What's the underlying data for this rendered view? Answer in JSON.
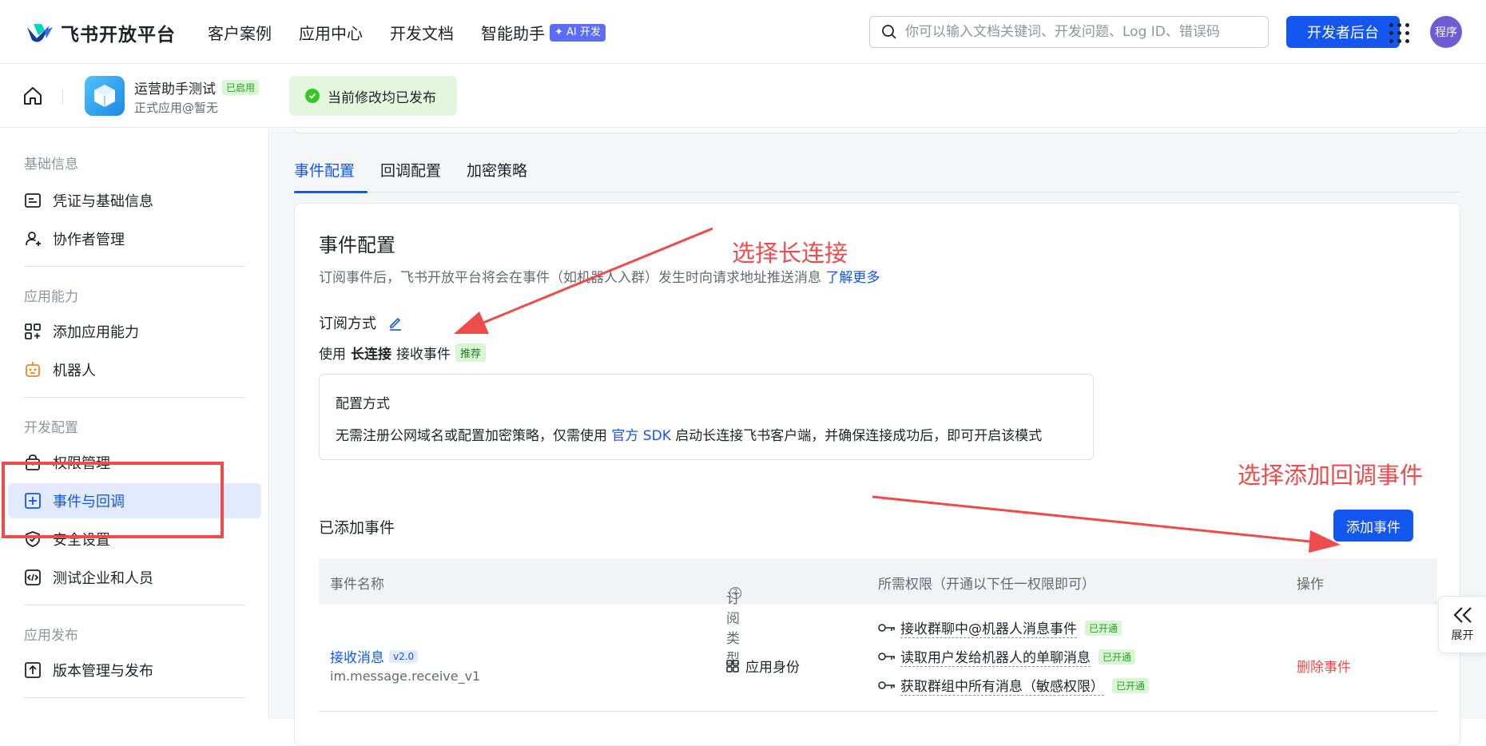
{
  "header": {
    "logo_text": "飞书开放平台",
    "nav": [
      {
        "label": "客户案例"
      },
      {
        "label": "应用中心"
      },
      {
        "label": "开发文档"
      },
      {
        "label": "智能助手",
        "badge": "AI 开发"
      }
    ],
    "search_placeholder": "你可以输入文档关键词、开发问题、Log ID、错误码",
    "dev_console_button": "开发者后台",
    "avatar_text": "程序"
  },
  "app": {
    "name": "运营助手测试",
    "status_tag": "已启用",
    "subtitle": "正式应用@暂无",
    "publish_status": "当前修改均已发布"
  },
  "sidebar": {
    "sections": [
      {
        "title": "基础信息",
        "items": [
          {
            "label": "凭证与基础信息",
            "icon": "credential-icon"
          },
          {
            "label": "协作者管理",
            "icon": "user-add-icon"
          }
        ]
      },
      {
        "title": "应用能力",
        "items": [
          {
            "label": "添加应用能力",
            "icon": "apps-add-icon"
          },
          {
            "label": "机器人",
            "icon": "robot-icon"
          }
        ]
      },
      {
        "title": "开发配置",
        "items": [
          {
            "label": "权限管理",
            "icon": "lock-bag-icon"
          },
          {
            "label": "事件与回调",
            "icon": "event-icon",
            "active": true
          },
          {
            "label": "安全设置",
            "icon": "shield-icon"
          },
          {
            "label": "测试企业和人员",
            "icon": "code-icon"
          }
        ]
      },
      {
        "title": "应用发布",
        "items": [
          {
            "label": "版本管理与发布",
            "icon": "upload-icon"
          }
        ]
      }
    ]
  },
  "tabs": [
    {
      "label": "事件配置",
      "active": true
    },
    {
      "label": "回调配置"
    },
    {
      "label": "加密策略"
    }
  ],
  "event_config": {
    "title": "事件配置",
    "desc": "订阅事件后，飞书开放平台将会在事件（如机器人入群）发生时向请求地址推送消息",
    "learn_more": "了解更多",
    "subscribe_title": "订阅方式",
    "use_prefix": "使用",
    "use_method": "长连接",
    "use_suffix": "接收事件",
    "recommend_tag": "推荐",
    "info_title": "配置方式",
    "info_text_1": "无需注册公网域名或配置加密策略，仅需使用",
    "info_link": "官方 SDK",
    "info_text_2": "启动长连接飞书客户端，并确保连接成功后，即可开启该模式"
  },
  "added_events": {
    "title": "已添加事件",
    "add_button": "添加事件",
    "columns": [
      "事件名称",
      "订阅类型",
      "所需权限（开通以下任一权限即可）",
      "操作"
    ],
    "rows": [
      {
        "name": "接收消息",
        "version": "v2.0",
        "code": "im.message.receive_v1",
        "sub_type": "应用身份",
        "permissions": [
          {
            "text": "接收群聊中@机器人消息事件",
            "status": "已开通"
          },
          {
            "text": "读取用户发给机器人的单聊消息",
            "status": "已开通"
          },
          {
            "text": "获取群组中所有消息（敏感权限）",
            "status": "已开通"
          }
        ],
        "action": "删除事件"
      }
    ]
  },
  "expand": {
    "label": "展开"
  },
  "annotations": {
    "long_conn": "选择长连接",
    "add_callback": "选择添加回调事件",
    "color": "#ee4b4b"
  }
}
